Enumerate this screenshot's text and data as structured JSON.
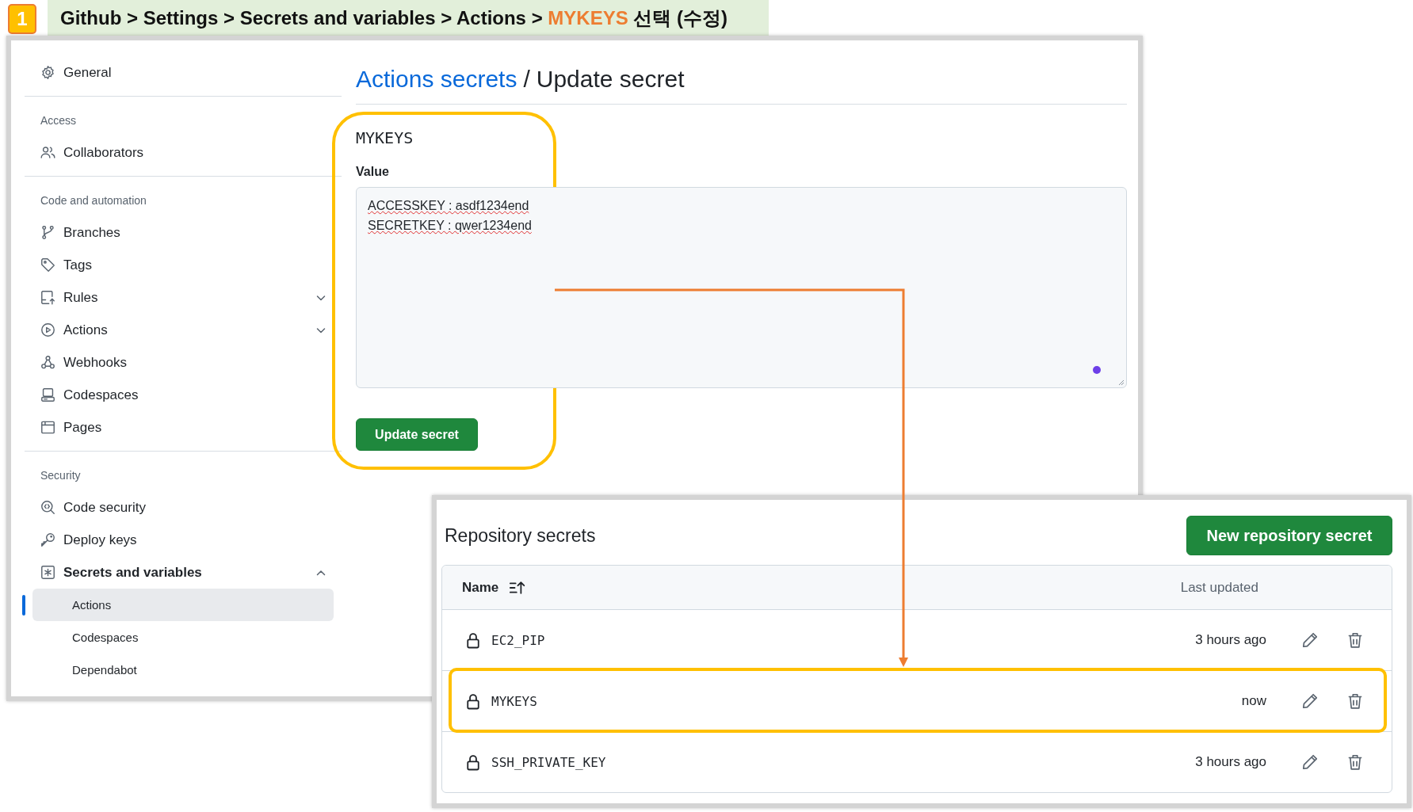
{
  "caption": {
    "step": "1",
    "parts": [
      {
        "text": "Github > Settings > Secrets and variables > Actions > ",
        "highlighted": false
      },
      {
        "text": "MYKEYS",
        "highlighted": true
      },
      {
        "text": " 선택 (수정)",
        "highlighted": false
      }
    ]
  },
  "sidebar": {
    "groups": [
      {
        "items": [
          {
            "label": "General"
          }
        ]
      },
      {
        "heading": "Access",
        "items": [
          {
            "label": "Collaborators"
          }
        ]
      },
      {
        "heading": "Code and automation",
        "items": [
          {
            "label": "Branches"
          },
          {
            "label": "Tags"
          },
          {
            "label": "Rules",
            "expanded": false
          },
          {
            "label": "Actions",
            "expanded": false
          },
          {
            "label": "Webhooks"
          },
          {
            "label": "Codespaces"
          },
          {
            "label": "Pages"
          }
        ]
      },
      {
        "heading": "Security",
        "items": [
          {
            "label": "Code security"
          },
          {
            "label": "Deploy keys"
          },
          {
            "label": "Secrets and variables",
            "expanded": true,
            "children": [
              {
                "label": "Actions",
                "selected": true
              },
              {
                "label": "Codespaces",
                "selected": false
              },
              {
                "label": "Dependabot",
                "selected": false
              }
            ]
          }
        ]
      }
    ]
  },
  "page": {
    "breadcrumb": {
      "link": "Actions secrets",
      "separator": "/",
      "current": "Update secret"
    },
    "secret_name": "MYKEYS",
    "form_highlighted": true,
    "value_label": "Value",
    "value_lines": [
      "ACCESSKEY : asdf1234end",
      "SECRETKEY : qwer1234end"
    ],
    "submit": "Update secret"
  },
  "repository_secrets": {
    "title": "Repository secrets",
    "new_button": "New repository secret",
    "columns": [
      "Name",
      "Last updated"
    ],
    "rows": [
      {
        "name": "EC2_PIP",
        "updated": "3 hours ago",
        "highlighted": false
      },
      {
        "name": "MYKEYS",
        "updated": "now",
        "highlighted": true
      },
      {
        "name": "SSH_PRIVATE_KEY",
        "updated": "3 hours ago",
        "highlighted": false
      }
    ]
  }
}
